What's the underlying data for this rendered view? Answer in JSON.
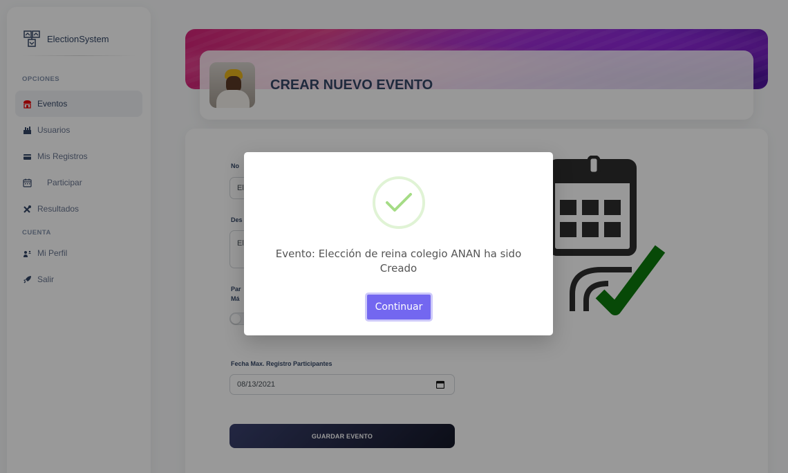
{
  "brand": {
    "name": "ElectionSystem"
  },
  "sidebar": {
    "section_options": "OPCIONES",
    "section_account": "CUENTA",
    "items": [
      {
        "label": "Eventos",
        "icon": "store-icon",
        "active": true
      },
      {
        "label": "Usuarios",
        "icon": "users-icon"
      },
      {
        "label": "Mis Registros",
        "icon": "credit-card-icon"
      },
      {
        "label": "Participar",
        "icon": "calendar-icon"
      },
      {
        "label": "Resultados",
        "icon": "tools-icon"
      }
    ],
    "account_items": [
      {
        "label": "Mi Perfil",
        "icon": "user-icon"
      },
      {
        "label": "Salir",
        "icon": "rocket-icon"
      }
    ]
  },
  "header": {
    "title": "CREAR NUEVO EVENTO"
  },
  "form": {
    "name_label": "No",
    "name_value": "El",
    "desc_label": "Des",
    "desc_value": "El",
    "part_label_1": "Par",
    "part_label_2": "Má",
    "date_label": "Fecha Max. Registro Participantes",
    "date_value": "08/13/2021",
    "save_label": "GUARDAR EVENTO"
  },
  "modal": {
    "message": "Evento: Elección de reina colegio ANAN ha sido Creado",
    "button_label": "Continuar",
    "success_color": "#a5dc86",
    "button_color": "#7367f0"
  }
}
